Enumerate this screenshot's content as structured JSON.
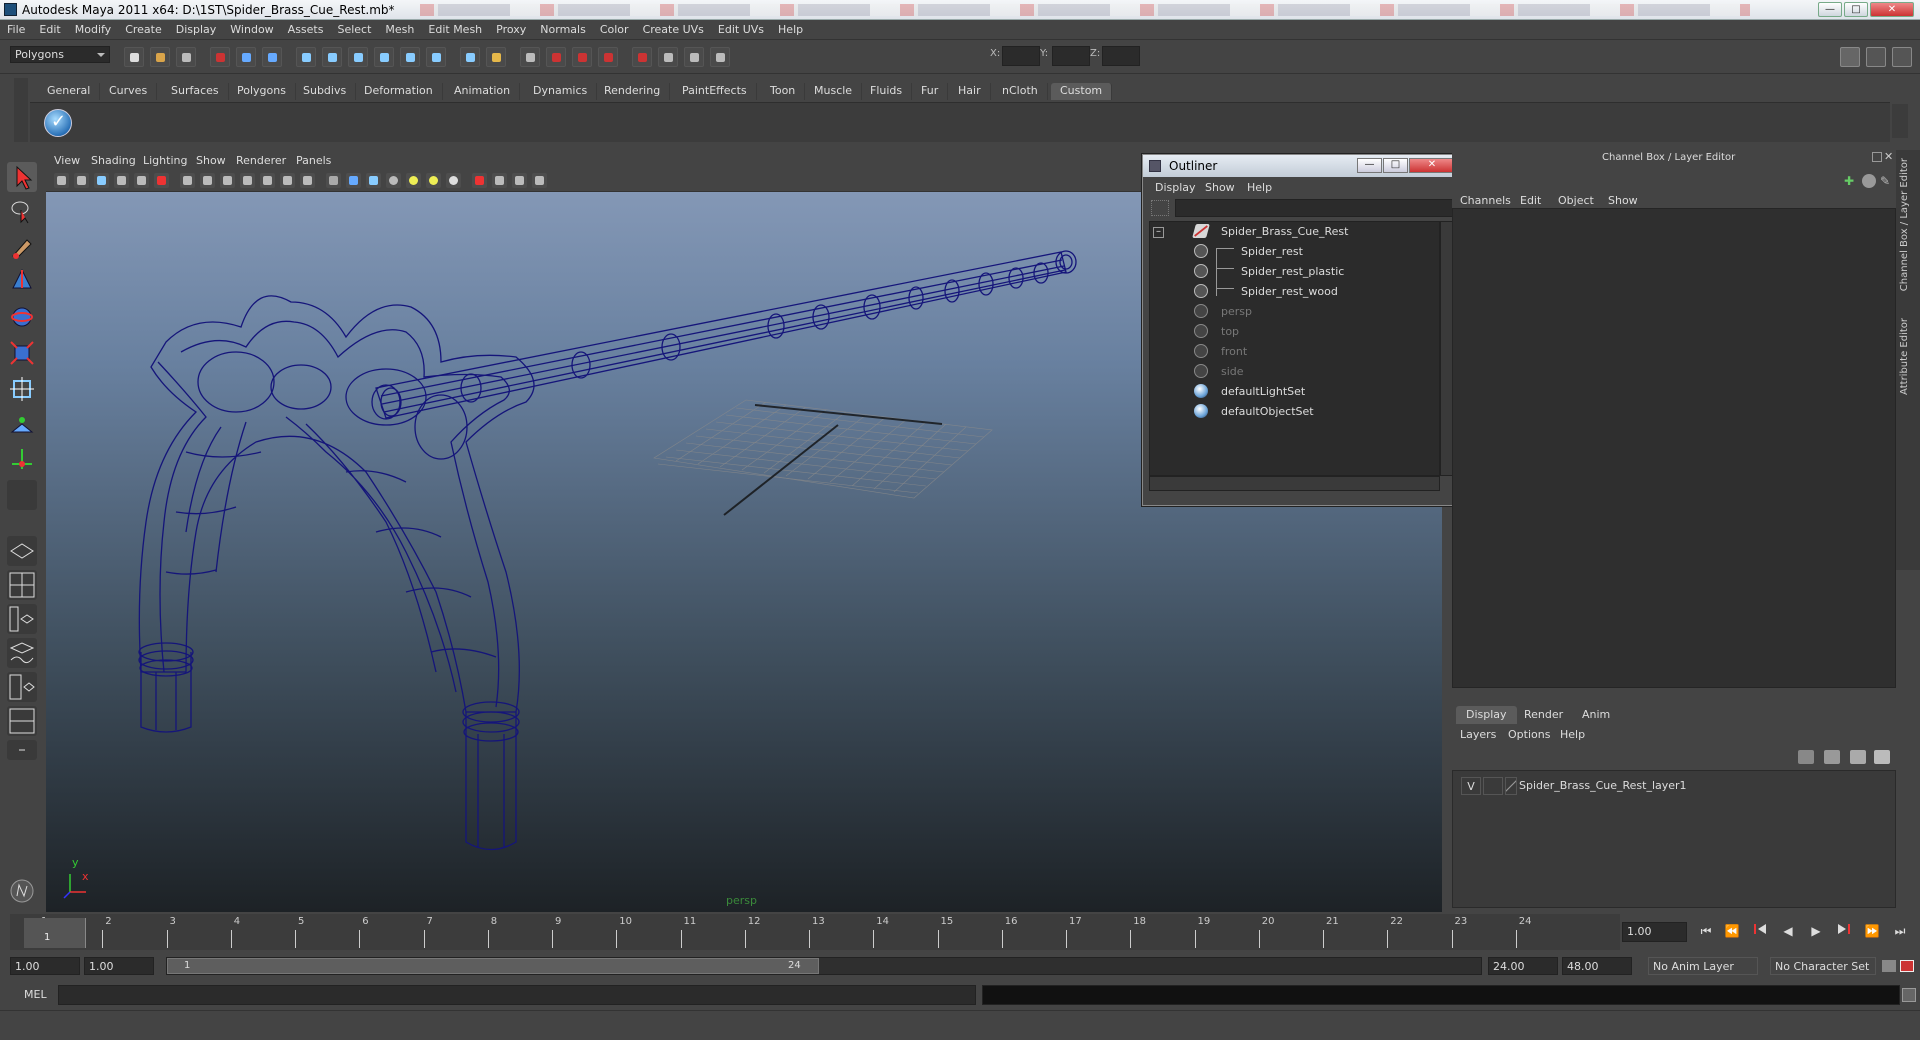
{
  "window": {
    "title": "Autodesk Maya 2011 x64: D:\\1ST\\Spider_Brass_Cue_Rest.mb*",
    "minimize": "—",
    "maximize": "□",
    "close": "✕"
  },
  "menubar": [
    "File",
    "Edit",
    "Modify",
    "Create",
    "Display",
    "Window",
    "Assets",
    "Select",
    "Mesh",
    "Edit Mesh",
    "Proxy",
    "Normals",
    "Color",
    "Create UVs",
    "Edit UVs",
    "Help"
  ],
  "status": {
    "mode": "Polygons",
    "x_label": "X:",
    "y_label": "Y:",
    "z_label": "Z:"
  },
  "shelf_tabs": [
    "General",
    "Curves",
    "Surfaces",
    "Polygons",
    "Subdivs",
    "Deformation",
    "Animation",
    "Dynamics",
    "Rendering",
    "PaintEffects",
    "Toon",
    "Muscle",
    "Fluids",
    "Fur",
    "Hair",
    "nCloth",
    "Custom"
  ],
  "shelf_active": "Custom",
  "viewport": {
    "menu": [
      "View",
      "Shading",
      "Lighting",
      "Show",
      "Renderer",
      "Panels"
    ],
    "camera_label": "persp",
    "axis_y": "y",
    "axis_x": "x"
  },
  "outliner": {
    "title": "Outliner",
    "menu": [
      "Display",
      "Show",
      "Help"
    ],
    "items": [
      {
        "name": "Spider_Brass_Cue_Rest",
        "type": "group",
        "dim": false
      },
      {
        "name": "Spider_rest",
        "type": "mesh",
        "dim": false
      },
      {
        "name": "Spider_rest_plastic",
        "type": "mesh",
        "dim": false
      },
      {
        "name": "Spider_rest_wood",
        "type": "mesh",
        "dim": false
      },
      {
        "name": "persp",
        "type": "camera",
        "dim": true
      },
      {
        "name": "top",
        "type": "camera",
        "dim": true
      },
      {
        "name": "front",
        "type": "camera",
        "dim": true
      },
      {
        "name": "side",
        "type": "camera",
        "dim": true
      },
      {
        "name": "defaultLightSet",
        "type": "set",
        "dim": false
      },
      {
        "name": "defaultObjectSet",
        "type": "set",
        "dim": false
      }
    ]
  },
  "channel_box": {
    "header": "Channel Box / Layer Editor",
    "menu": [
      "Channels",
      "Edit",
      "Object",
      "Show"
    ],
    "side_tab1": "Channel Box / Layer Editor",
    "side_tab2": "Attribute Editor"
  },
  "layer_editor": {
    "tabs": [
      "Display",
      "Render",
      "Anim"
    ],
    "active_tab": "Display",
    "menu": [
      "Layers",
      "Options",
      "Help"
    ],
    "layer": {
      "visible": "V",
      "name": "Spider_Brass_Cue_Rest_layer1"
    }
  },
  "timeline": {
    "ticks": [
      1,
      2,
      3,
      4,
      5,
      6,
      7,
      8,
      9,
      10,
      11,
      12,
      13,
      14,
      15,
      16,
      17,
      18,
      19,
      20,
      21,
      22,
      23,
      24
    ],
    "current_frame": "1",
    "current_time": "1.00"
  },
  "range": {
    "start_time": "1.00",
    "playback_start": "1.00",
    "slider_start": "1",
    "slider_end": "24",
    "playback_end": "24.00",
    "end_time": "48.00",
    "anim_layer": "No Anim Layer",
    "char_set": "No Character Set"
  },
  "command_line": {
    "label": "MEL"
  },
  "colors": {
    "wire": "#15157a",
    "accent": "#5b5b5b"
  }
}
